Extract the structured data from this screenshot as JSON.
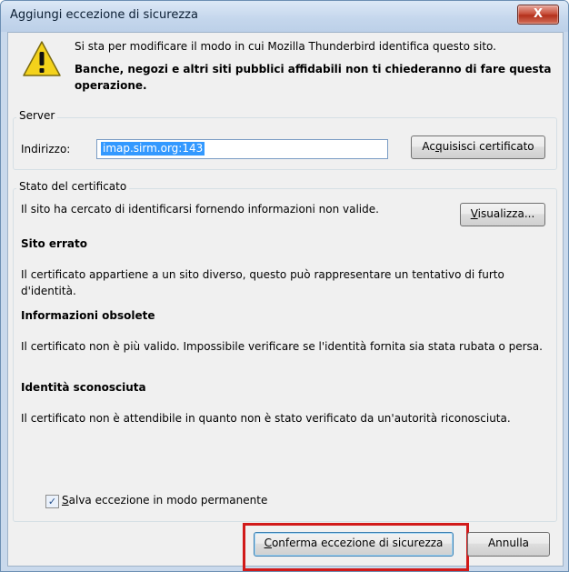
{
  "window": {
    "title": "Aggiungi eccezione di sicurezza",
    "close_label": "X"
  },
  "message": {
    "line1": "Si sta per modificare il modo in cui Mozilla Thunderbird identifica questo sito.",
    "line2": "Banche, negozi e altri siti pubblici affidabili non ti chiederanno di fare questa operazione."
  },
  "server": {
    "group_label": "Server",
    "address_label": "Indirizzo:",
    "address_value": "imap.sirm.org:143",
    "acquire_button": {
      "pre": "Ac",
      "accel": "q",
      "post": "uisisci certificato"
    }
  },
  "status": {
    "group_label": "Stato del certificato",
    "intro": "Il sito ha cercato di identificarsi fornendo informazioni non valide.",
    "view_button": {
      "accel": "V",
      "post": "isualizza..."
    },
    "sections": [
      {
        "heading": "Sito errato",
        "text": "Il certificato appartiene a un sito diverso, questo può rappresentare un tentativo di furto d'identità."
      },
      {
        "heading": "Informazioni obsolete",
        "text": "Il certificato non è più valido. Impossibile verificare se l'identità fornita sia stata rubata o persa."
      },
      {
        "heading": "Identità sconosciuta",
        "text": "Il certificato non è attendibile in quanto non è stato verificato da un'autorità riconosciuta."
      }
    ],
    "permanent_checkbox": {
      "checked": true,
      "check_glyph": "✓",
      "accel": "S",
      "post": "alva eccezione in modo permanente"
    }
  },
  "buttons": {
    "confirm": {
      "accel": "C",
      "post": "onferma eccezione di sicurezza"
    },
    "cancel": "Annulla"
  },
  "colors": {
    "highlight": "#d11a1a",
    "selection": "#3399ff",
    "warning_fill": "#f4d21b"
  },
  "icons": {
    "warning": "warning-icon",
    "close": "close-icon"
  }
}
